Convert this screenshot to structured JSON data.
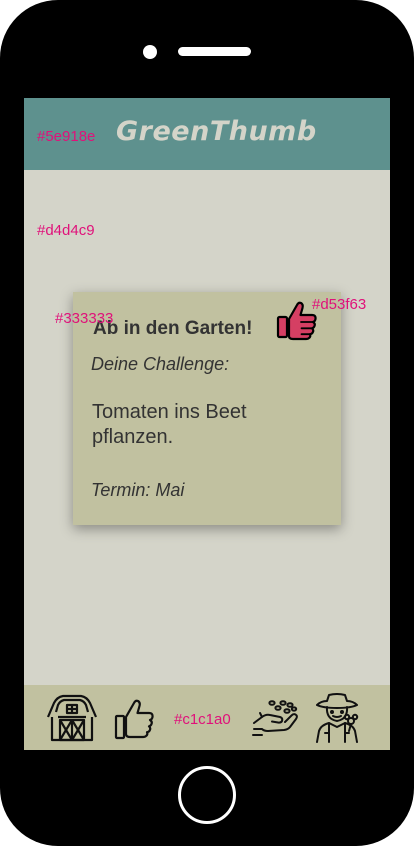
{
  "app": {
    "title": "GreenThumb"
  },
  "colors": {
    "header": "#5e918e",
    "background": "#d4d4c9",
    "text": "#333333",
    "accent": "#d53f63",
    "card_and_nav": "#c1c1a0"
  },
  "annotations": {
    "header_color": "#5e918e",
    "background_color": "#d4d4c9",
    "text_color": "#333333",
    "accent_color": "#d53f63",
    "nav_color": "#c1c1a0"
  },
  "card": {
    "title": "Ab in den Garten!",
    "subtitle": "Deine Challenge:",
    "task": "Tomaten ins Beet pflanzen.",
    "date": "Termin: Mai",
    "like_icon": "thumbs-up-icon"
  },
  "nav": {
    "items": [
      {
        "icon": "barn-icon"
      },
      {
        "icon": "thumbs-up-icon"
      },
      {
        "icon": "seeds-hand-icon"
      },
      {
        "icon": "gardener-icon"
      }
    ]
  }
}
